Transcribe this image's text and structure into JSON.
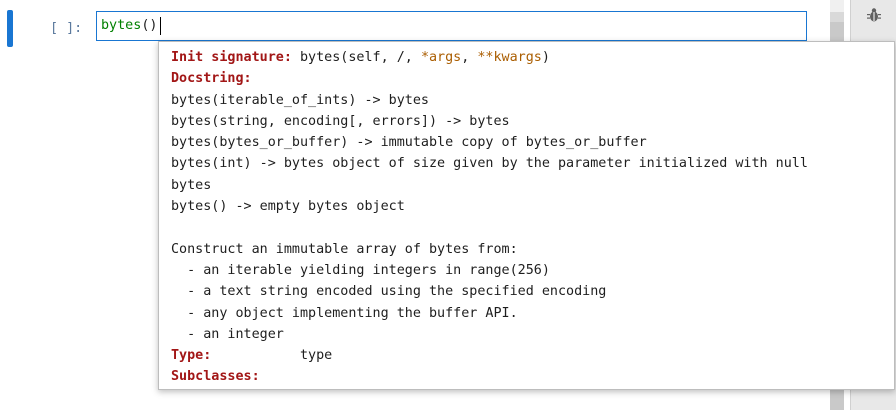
{
  "cell": {
    "prompt": "[ ]:",
    "code_name": "bytes",
    "code_parens": "()"
  },
  "toolbar": {
    "debug_icon": "bug-icon"
  },
  "tooltip": {
    "init_label": "Init signature:",
    "sig_name": " bytes(self, /, ",
    "sig_args": "*args",
    "sig_sep": ", ",
    "sig_kwargs": "**kwargs",
    "sig_end": ")",
    "docstring_label": "Docstring:",
    "doc_lines": [
      "bytes(iterable_of_ints) -> bytes",
      "bytes(string, encoding[, errors]) -> bytes",
      "bytes(bytes_or_buffer) -> immutable copy of bytes_or_buffer",
      "bytes(int) -> bytes object of size given by the parameter initialized with null",
      "bytes",
      "bytes() -> empty bytes object"
    ],
    "construct_lines": [
      "Construct an immutable array of bytes from:",
      "  - an iterable yielding integers in range(256)",
      "  - a text string encoded using the specified encoding",
      "  - any object implementing the buffer API.",
      "  - an integer"
    ],
    "type_label": "Type:",
    "type_value": "type",
    "subclasses_label": "Subclasses:"
  }
}
